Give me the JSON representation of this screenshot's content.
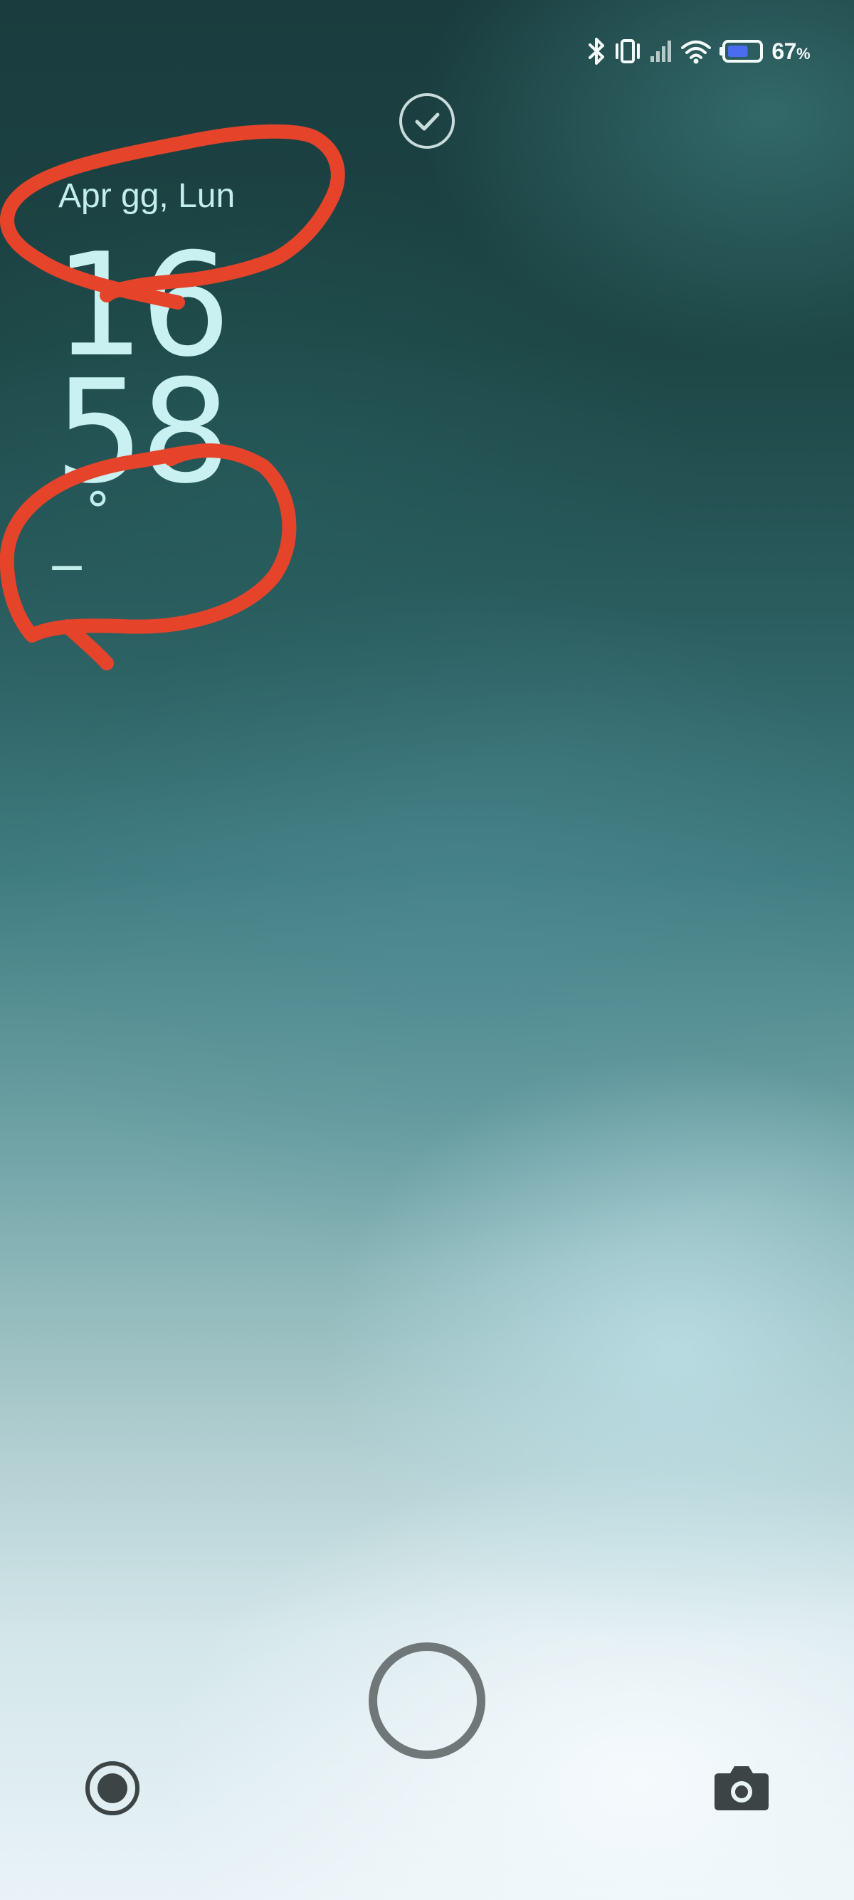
{
  "status_bar": {
    "icons": [
      "bluetooth-icon",
      "vibrate-icon",
      "cell-signal-icon",
      "wifi-icon",
      "battery-icon"
    ],
    "battery_percent": 67,
    "battery_value": "67",
    "battery_unit": "%",
    "battery_fill_color": "#4a6cf0"
  },
  "lockscreen": {
    "date": "Apr gg, Lun",
    "clock_hour": "16",
    "clock_minute": "58",
    "weather_temp": "_",
    "weather_degree": "°"
  },
  "annotation_color": "#e5442b",
  "bottom_controls": {
    "left_icon": "record-icon",
    "center_icon": "unlock-ring",
    "right_icon": "camera-icon"
  }
}
